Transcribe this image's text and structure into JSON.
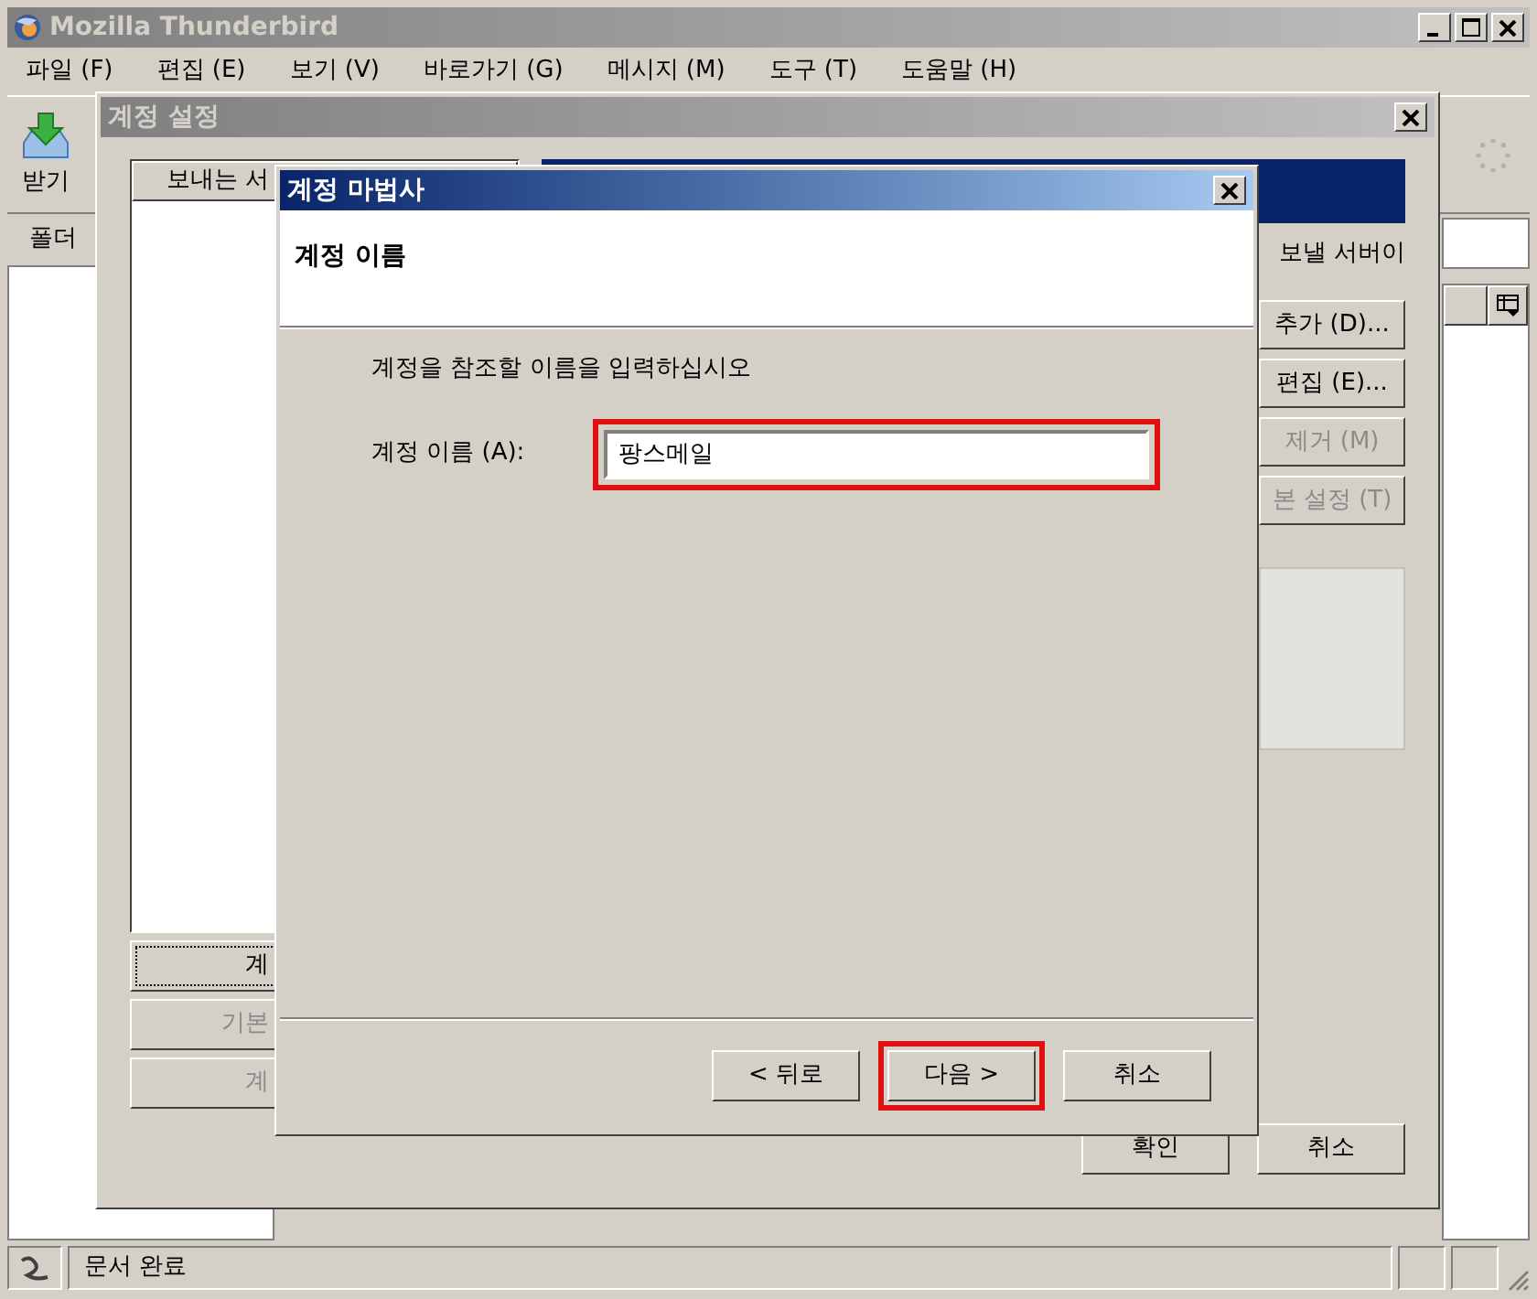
{
  "main_window": {
    "title": "Mozilla Thunderbird",
    "menu": [
      "파일 (F)",
      "편집 (E)",
      "보기 (V)",
      "바로가기 (G)",
      "메시지 (M)",
      "도구 (T)",
      "도움말 (H)"
    ],
    "toolbar": [
      {
        "label": "받기"
      }
    ],
    "folder_pane": {
      "header": "폴더"
    },
    "status_bar": {
      "text": "문서 완료"
    }
  },
  "account_settings": {
    "title": "계정 설정",
    "list_header": "보내는 서",
    "left_buttons": [
      {
        "label": "계",
        "disabled": false,
        "focused": true
      },
      {
        "label": "기본",
        "disabled": true,
        "focused": false
      },
      {
        "label": "계",
        "disabled": true,
        "focused": false
      }
    ],
    "server_text": "보낼 서버이",
    "right_buttons": [
      {
        "label": "추가 (D)...",
        "disabled": false
      },
      {
        "label": "편집 (E)...",
        "disabled": false
      },
      {
        "label": "제거 (M)",
        "disabled": true
      },
      {
        "label": "본 설정 (T)",
        "disabled": true
      }
    ],
    "buttons": [
      "확인",
      "취소"
    ]
  },
  "wizard": {
    "title": "계정 마법사",
    "header": "계정 이름",
    "prompt": "계정을 참조할 이름을 입력하십시오",
    "field": {
      "label": "계정 이름 (A):",
      "value": "팡스메일",
      "highlighted": true
    },
    "buttons": [
      {
        "label": "< 뒤로",
        "highlighted": false
      },
      {
        "label": "다음 >",
        "highlighted": true
      },
      {
        "label": "취소",
        "highlighted": false
      }
    ]
  }
}
